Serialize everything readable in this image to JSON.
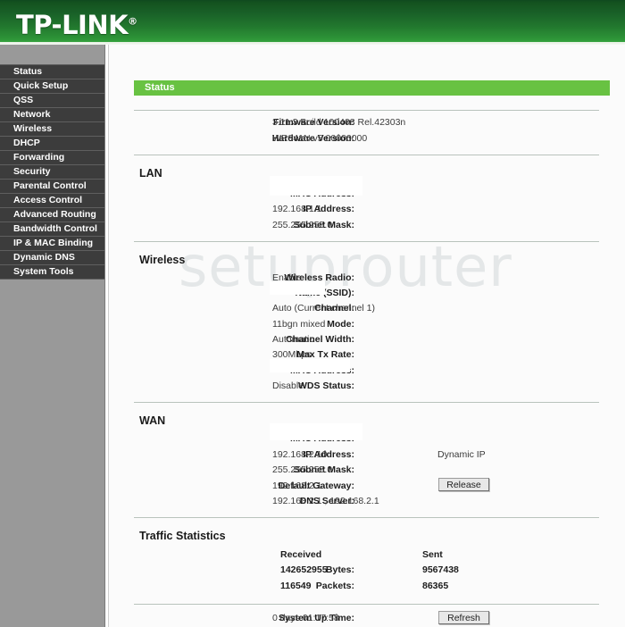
{
  "header": {
    "brand": "TP-LINK",
    "registered_mark": "®"
  },
  "sidebar": {
    "items": [
      {
        "label": "Status"
      },
      {
        "label": "Quick Setup"
      },
      {
        "label": "QSS"
      },
      {
        "label": "Network"
      },
      {
        "label": "Wireless"
      },
      {
        "label": "DHCP"
      },
      {
        "label": "Forwarding"
      },
      {
        "label": "Security"
      },
      {
        "label": "Parental Control"
      },
      {
        "label": "Access Control"
      },
      {
        "label": "Advanced Routing"
      },
      {
        "label": "Bandwidth Control"
      },
      {
        "label": "IP & MAC Binding"
      },
      {
        "label": "Dynamic DNS"
      },
      {
        "label": "System Tools"
      }
    ]
  },
  "watermark": "setuprouter",
  "main": {
    "page_title": "Status",
    "device": {
      "firmware_label": "Firmware Version:",
      "firmware_value": "3.11.3 Build 100408 Rel.42303n",
      "hardware_label": "Hardware Version:",
      "hardware_value": "WR841N v5 00000000"
    },
    "lan": {
      "title": "LAN",
      "mac_label": "MAC Address:",
      "mac_value": "",
      "ip_label": "IP Address:",
      "ip_value": "192.168.1.1",
      "mask_label": "Subnet Mask:",
      "mask_value": "255.255.255.0"
    },
    "wireless": {
      "title": "Wireless",
      "radio_label": "Wireless Radio:",
      "radio_value": "Enable",
      "ssid_label": "Name (SSID):",
      "ssid_value": "",
      "channel_label": "Channel:",
      "channel_value": "Auto (Current channel 1)",
      "mode_label": "Mode:",
      "mode_value": "11bgn mixed",
      "width_label": "Channel Width:",
      "width_value": "Automatic",
      "txrate_label": "Max Tx Rate:",
      "txrate_value": "300Mbps",
      "mac_label": "MAC Address:",
      "mac_value": "",
      "wds_label": "WDS Status:",
      "wds_value": "Disable"
    },
    "wan": {
      "title": "WAN",
      "mac_label": "MAC Address:",
      "mac_value": "",
      "ip_label": "IP Address:",
      "ip_value": "192.168.2.10",
      "conn_type": "Dynamic IP",
      "mask_label": "Subnet Mask:",
      "mask_value": "255.255.255.0",
      "gateway_label": "Default Gateway:",
      "gateway_value": "192.168.2.1",
      "release_button": "Release",
      "dns_label": "DNS Server:",
      "dns_value": "192.168.2.1 , 192.168.2.1"
    },
    "traffic": {
      "title": "Traffic Statistics",
      "col_received": "Received",
      "col_sent": "Sent",
      "bytes_label": "Bytes:",
      "bytes_received": "142652955",
      "bytes_sent": "9567438",
      "packets_label": "Packets:",
      "packets_received": "116549",
      "packets_sent": "86365"
    },
    "footer": {
      "uptime_label": "System Up Time:",
      "uptime_value": "0 days 01:17:58",
      "refresh_button": "Refresh"
    }
  },
  "colors": {
    "brand_green": "#68c242",
    "header_dark": "#0f4a1f",
    "sidebar_dark": "#3c3c3c"
  }
}
